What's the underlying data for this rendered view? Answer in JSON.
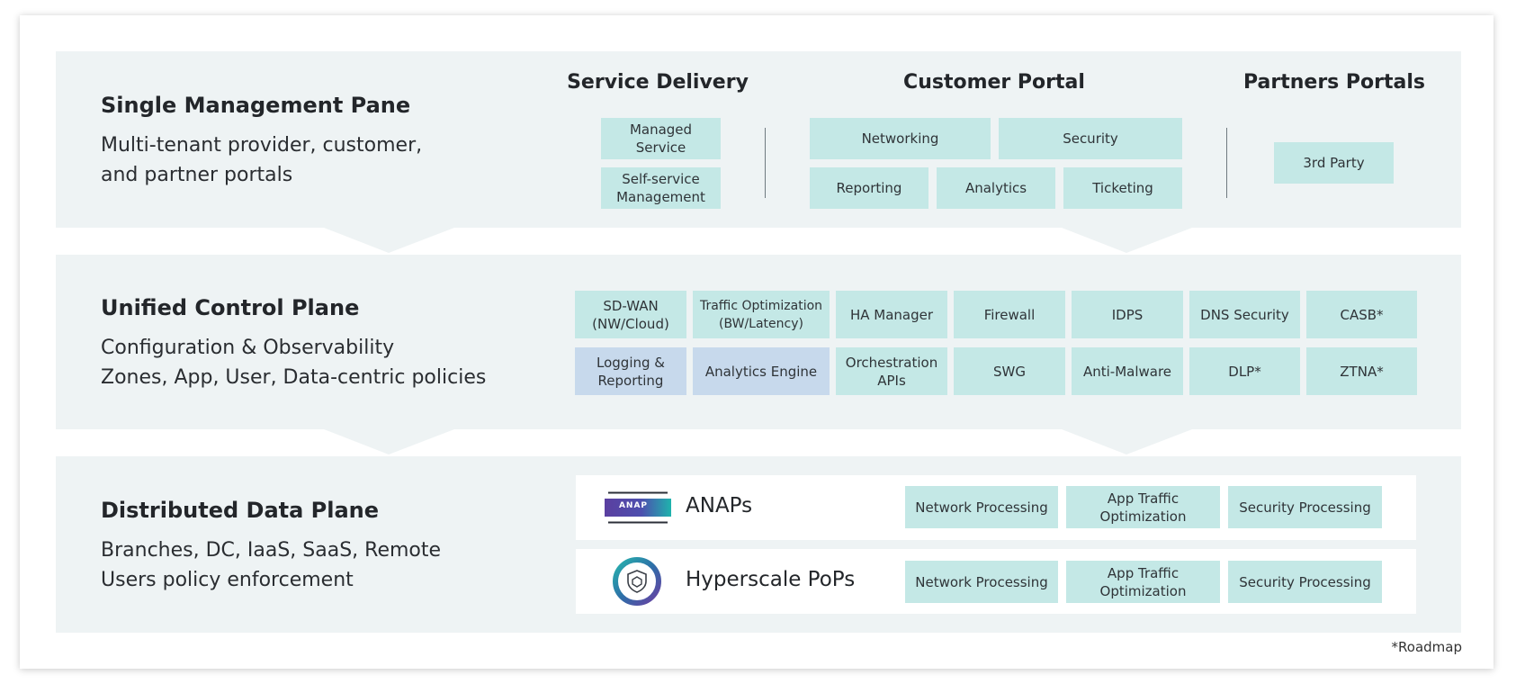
{
  "management": {
    "title": "Single Management Pane",
    "desc_line1": "Multi-tenant provider, customer,",
    "desc_line2": "and partner portals",
    "service_delivery": {
      "heading": "Service Delivery",
      "items": [
        "Managed Service",
        "Self-service Management"
      ]
    },
    "customer_portal": {
      "heading": "Customer Portal",
      "items": [
        "Networking",
        "Security",
        "Reporting",
        "Analytics",
        "Ticketing"
      ]
    },
    "partners_portals": {
      "heading": "Partners Portals",
      "items": [
        "3rd Party"
      ]
    }
  },
  "control": {
    "title": "Unified Control Plane",
    "desc_line1": "Configuration & Observability",
    "desc_line2": "Zones, App, User, Data-centric policies",
    "row1": [
      "SD-WAN (NW/Cloud)",
      "Traffic Optimization (BW/Latency)",
      "HA Manager",
      "Firewall",
      "IDPS",
      "DNS Security",
      "CASB*"
    ],
    "row2": [
      "Logging & Reporting",
      "Analytics Engine",
      "Orchestration APIs",
      "SWG",
      "Anti-Malware",
      "DLP*",
      "ZTNA*"
    ]
  },
  "data_plane": {
    "title": "Distributed Data Plane",
    "desc_line1": "Branches, DC, IaaS, SaaS, Remote",
    "desc_line2": "Users policy enforcement",
    "anaps": {
      "logo_text": "ANAP",
      "label": "ANAPs",
      "items": [
        "Network Processing",
        "App Traffic Optimization",
        "Security Processing"
      ]
    },
    "pops": {
      "label": "Hyperscale PoPs",
      "items": [
        "Network Processing",
        "App Traffic Optimization",
        "Security Processing"
      ]
    }
  },
  "footnote": "*Roadmap",
  "colors": {
    "band": "#eef3f4",
    "teal_box": "#c4e8e6",
    "blue_box": "#c7d9ec",
    "anap_purple": "#5b3fa0",
    "anap_teal": "#1fb3ad"
  }
}
